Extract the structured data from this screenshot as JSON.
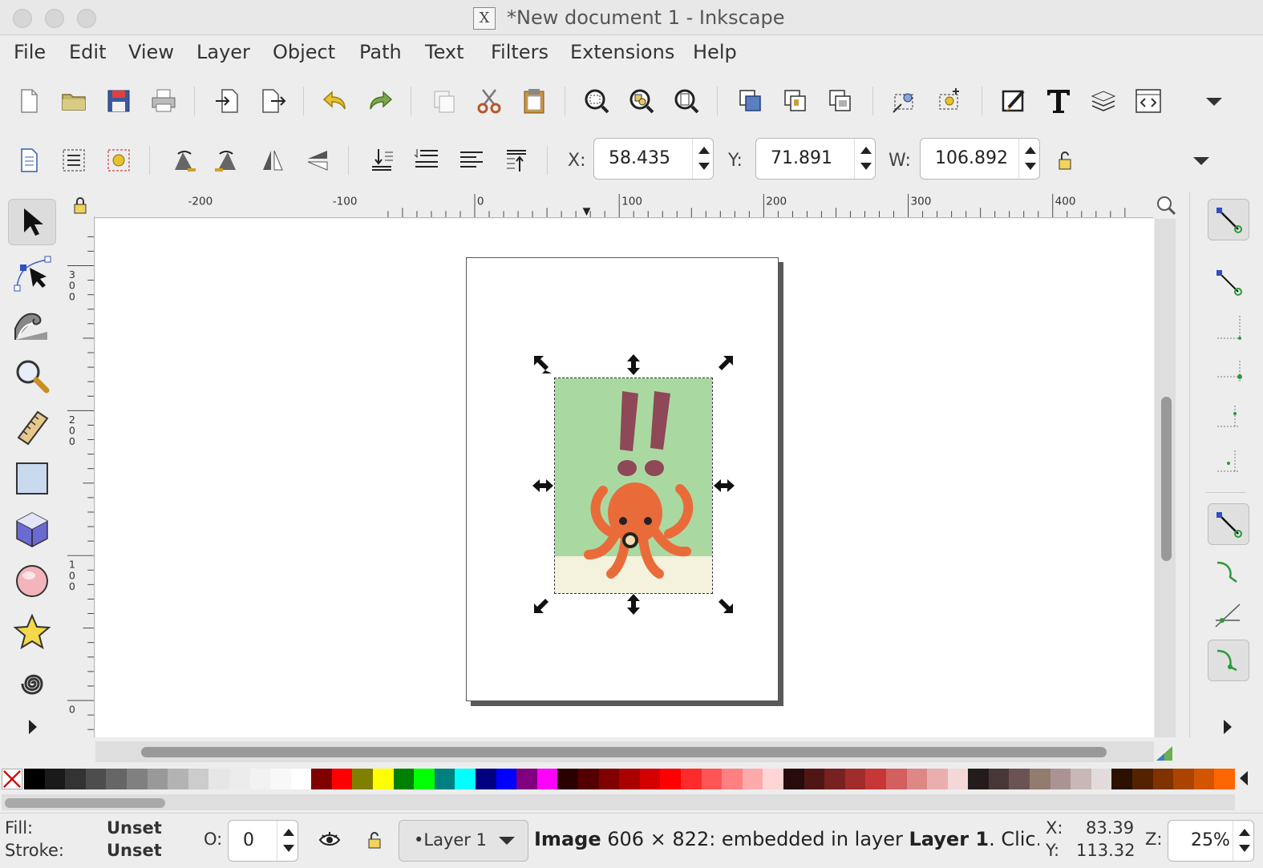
{
  "window": {
    "title": "*New document 1 - Inkscape",
    "title_icon": "X"
  },
  "menu": [
    "File",
    "Edit",
    "View",
    "Layer",
    "Object",
    "Path",
    "Text",
    "Filters",
    "Extensions",
    "Help"
  ],
  "commands_toolbar": {
    "icons": [
      "new-document-icon",
      "open-icon",
      "save-icon",
      "print-icon",
      "import-icon",
      "export-icon",
      "undo-icon",
      "redo-icon",
      "duplicate-icon",
      "cut-icon",
      "paste-icon",
      "zoom-selection-icon",
      "zoom-drawing-icon",
      "zoom-page-icon",
      "group-icon",
      "ungroup-icon",
      "clone-icon",
      "unlink-icon",
      "node-editor-icon",
      "xml-editor-icon",
      "text-font-icon",
      "layers-icon",
      "document-properties-icon"
    ]
  },
  "select_toolbar": {
    "x_label": "X:",
    "x_value": "58.435",
    "y_label": "Y:",
    "y_value": "71.891",
    "w_label": "W:",
    "w_value": "106.892"
  },
  "tools": [
    "selector-tool-icon",
    "node-tool-icon",
    "tweak-tool-icon",
    "zoom-tool-icon",
    "measure-tool-icon",
    "rectangle-tool-icon",
    "3dbox-tool-icon",
    "ellipse-tool-icon",
    "star-tool-icon",
    "spiral-tool-icon",
    "more-tools-icon"
  ],
  "rulers": {
    "horizontal": [
      "-200",
      "-100",
      "0",
      "100",
      "200",
      "300",
      "400"
    ],
    "vertical": [
      "300",
      "200",
      "100",
      "0"
    ]
  },
  "image": {
    "description_colors": {
      "background": "#a9d9a1",
      "octopus": "#ea6b3a",
      "exclaim": "#8e4857",
      "floor": "#f4f1dc"
    }
  },
  "palette": [
    "#000000",
    "#1a1a1a",
    "#333333",
    "#4d4d4d",
    "#666666",
    "#808080",
    "#999999",
    "#b3b3b3",
    "#cccccc",
    "#e6e6e6",
    "#ececec",
    "#f2f2f2",
    "#f8f8f8",
    "#ffffff",
    "#800000",
    "#ff0000",
    "#808000",
    "#ffff00",
    "#008000",
    "#00ff00",
    "#008080",
    "#00ffff",
    "#000080",
    "#0000ff",
    "#800080",
    "#ff00ff",
    "#2b0000",
    "#550000",
    "#800000",
    "#aa0000",
    "#d40000",
    "#ff0000",
    "#ff2a2a",
    "#ff5555",
    "#ff8080",
    "#ffaaaa",
    "#ffd5d5",
    "#280b0b",
    "#501616",
    "#782121",
    "#a02c2c",
    "#c83737",
    "#d35f5f",
    "#de8787",
    "#e9afaf",
    "#f4d7d7",
    "#241c1c",
    "#483737",
    "#6c5353",
    "#917c6f",
    "#ac9393",
    "#c8b7b7",
    "#e3dbdb",
    "#2b1100",
    "#552200",
    "#803300",
    "#aa4400",
    "#d45500",
    "#ff6600"
  ],
  "status": {
    "fill_label": "Fill:",
    "fill_value": "Unset",
    "stroke_label": "Stroke:",
    "stroke_value": "Unset",
    "opacity_label": "O:",
    "opacity_value": "0",
    "layer": "•Layer 1",
    "msg_bold1": "Image",
    "msg_text1": " 606 × 822: embedded in layer ",
    "msg_bold2": "Layer 1",
    "msg_text2": ". Clic…",
    "x_label": "X:",
    "x_value": "83.39",
    "y_label": "Y:",
    "y_value": "113.32",
    "z_label": "Z:",
    "zoom_value": "25%"
  }
}
